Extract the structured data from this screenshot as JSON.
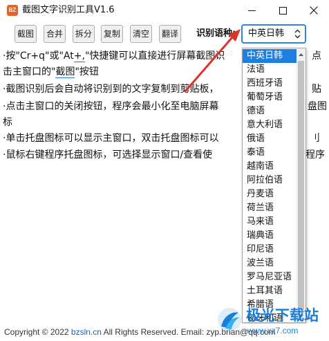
{
  "window": {
    "icon_text": "BZ",
    "title": "截图文字识别工具V1.6"
  },
  "toolbar": {
    "buttons": [
      "截图",
      "合并",
      "拆分",
      "复制",
      "清空",
      "翻译"
    ],
    "lang_label": "识别语种:",
    "lang_selected": "中英日韩"
  },
  "main": {
    "line1_a": "·按\"Cr+q\"或\"At",
    "line1_link": "+,",
    "line1_b": "\"快捷键可以直接进行屏幕截图识",
    "line1_tail": "点",
    "line2_a": "击主窗口的\"",
    "line2_link": "截图",
    "line2_b": "\"按钮",
    "line3": "·截图识别后会自动将识别到的文字复制到剪贴板，",
    "line3_tail": "贴",
    "line4": "·点击主窗口的关闭按钮，程序会最小化至电脑屏幕",
    "line4_tail": "盘图",
    "line5": "标",
    "line6": "·单击托盘图标可以显示主窗口，双击托盘图标可以",
    "line6_tail": "刂",
    "line7": "·鼠标右键程序托盘图标，可选择显示窗口/查看使",
    "line7_tail": "程序"
  },
  "dropdown": {
    "options": [
      "中英日韩",
      "法语",
      "西班牙语",
      "葡萄牙语",
      "德语",
      "意大利语",
      "俄语",
      "泰语",
      "越南语",
      "阿拉伯语",
      "丹麦语",
      "荷兰语",
      "马来语",
      "瑞典语",
      "印尼语",
      "波兰语",
      "罗马尼亚语",
      "土耳其语",
      "希腊语",
      "匈牙利语"
    ],
    "selected_index": 0
  },
  "footer": {
    "copyright_a": "Copyright © 2022 ",
    "site": "bzsln.cn",
    "copyright_b": "  All Rights Reserved.  Email: zyp.brian@qq.com"
  },
  "watermark": {
    "name": "极光下载站",
    "url": "www.xz7.com"
  },
  "colors": {
    "accent": "#1e7fe0",
    "select_border": "#2f84dd",
    "arrow": "#e0302a",
    "app_icon": "#e8632a"
  }
}
